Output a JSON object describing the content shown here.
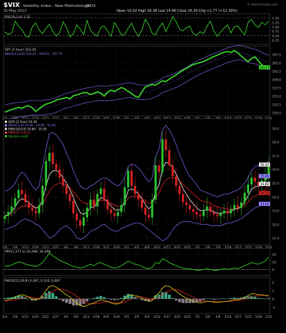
{
  "header": {
    "ticker": "$VIX",
    "name": "Volatility Index - New Methodology",
    "exchange": "INDX",
    "date": "31-May-2013",
    "quote": "Open 16.02  High 16.38  Low 14.96  Close 16.30  Chg +1.77 (+12.18%)",
    "watermark": "© StockCharts.com"
  },
  "colors": {
    "background": "#000000",
    "panel_border": "#3a3a3a",
    "grid": "#2a2a2a",
    "green_line": "#39d52b",
    "up_candle": "#2fbf2f",
    "down_candle": "#d22222",
    "band": "#6a5acd",
    "white_ma": "#e8e8e8",
    "red_ma": "#cc2222",
    "macd": "#d8c31c",
    "signal": "#cc2222",
    "hist_pos": "#3aa98a",
    "hist_neg": "#8a7f88",
    "label": "#bbbbbb"
  },
  "x_axis": {
    "labels": [
      "2/4",
      "2/8",
      "2/13",
      "2/19",
      "2/22",
      "2/27",
      "3/4",
      "3/8",
      "3/13",
      "3/18",
      "3/21",
      "3/26",
      "4/1",
      "4/5",
      "4/9",
      "4/12",
      "4/17",
      "4/22",
      "4/25",
      "5/1",
      "5/6",
      "5/9",
      "5/14",
      "5/17",
      "5/22",
      "5/28",
      "5/31"
    ]
  },
  "chart_data": [
    {
      "panel": "rsi",
      "type": "line",
      "legend": "RSI(20,2.0) 1.32",
      "y_ticks": [
        "1.50",
        "1.25",
        "1.00",
        "0.75",
        "0.50",
        "0.25"
      ],
      "ylim": [
        0.1,
        1.65
      ],
      "values": [
        0.72,
        0.58,
        0.66,
        1.32,
        1.05,
        0.84,
        0.51,
        0.43,
        1.01,
        1.22,
        0.84,
        0.62,
        0.92,
        1.15,
        0.74,
        0.49,
        0.68,
        1.28,
        0.97,
        0.44,
        0.63,
        1.11,
        0.88,
        0.56,
        1.36,
        0.81,
        0.59,
        0.49,
        0.97,
        1.05,
        0.76,
        0.48,
        1.24,
        0.95,
        0.53,
        0.58,
        0.93,
        1.21,
        0.77,
        0.47,
        0.82,
        1.43,
        1.12,
        0.63,
        0.57,
        0.96,
        1.22,
        0.74,
        1.14,
        1.58,
        1.28,
        0.88,
        0.78,
        0.96,
        1.04,
        0.61,
        0.54,
        0.73,
        0.62,
        1.04,
        1.32,
        0.77,
        0.48,
        0.72,
        0.94,
        1.11,
        0.66,
        1.02,
        1.05,
        0.79,
        0.56,
        1.25,
        1.41,
        1.12,
        0.96,
        1.26,
        1.12,
        1.32
      ]
    },
    {
      "panel": "spy",
      "type": "line",
      "legend": "SPY (2 hour) 163.45",
      "legend2": "BB(20,2.0,20) 163.47 - 160.51 - 157.75",
      "y_ticks": [
        "167.5",
        "165.0",
        "162.5",
        "160.0",
        "157.5",
        "155.0",
        "152.5",
        "150.0"
      ],
      "price_box": "163.45",
      "ylim": [
        149.5,
        169.5
      ],
      "values": [
        150.2,
        150.6,
        151.0,
        151.3,
        151.6,
        151.4,
        151.9,
        152.1,
        151.5,
        150.4,
        151.2,
        152.0,
        152.6,
        152.9,
        153.3,
        153.8,
        154.1,
        154.3,
        154.6,
        154.2,
        155.1,
        155.4,
        155.7,
        156.1,
        156.0,
        155.5,
        155.8,
        156.3,
        155.9,
        155.0,
        156.2,
        156.8,
        156.4,
        157.0,
        157.6,
        157.2,
        156.4,
        155.8,
        155.0,
        154.6,
        156.3,
        157.8,
        158.1,
        158.5,
        158.3,
        159.0,
        159.6,
        159.4,
        160.1,
        160.8,
        161.4,
        162.1,
        162.8,
        163.4,
        164.0,
        164.5,
        164.8,
        165.1,
        165.4,
        165.9,
        166.4,
        166.9,
        167.3,
        167.8,
        168.2,
        168.4,
        168.1,
        168.7,
        168.0,
        167.0,
        166.2,
        165.4,
        166.3,
        166.8,
        165.6,
        164.4,
        163.8,
        163.45
      ]
    },
    {
      "panel": "vix",
      "type": "candlestick",
      "legend": [
        {
          "text": "$VIX (2 hour) 16.30",
          "color": "#e8e8e8"
        },
        {
          "text": "BB(20,2.0) 15.46 - 14.80 - 13.44",
          "color": "#8f82ff"
        },
        {
          "text": "EMA(10,0.0) 14.89 - 15.35",
          "color": "#e8e8e8"
        },
        {
          "text": "EMA(10) 14.23",
          "color": "#ff4b4b"
        },
        {
          "text": "Volume undef",
          "color": "#39d52b"
        }
      ],
      "y_ticks": [
        "19.0",
        "18.0",
        "17.0",
        "16.0",
        "15.0",
        "14.0",
        "13.0",
        "12.0",
        "11.0"
      ],
      "price_boxes": [
        "16.30",
        "15.46",
        "14.89",
        "14.23",
        "13.44"
      ],
      "ylim": [
        10.6,
        19.6
      ],
      "values": [
        12.6,
        12.9,
        13.3,
        13.9,
        14.5,
        14.2,
        13.6,
        13.2,
        13.0,
        12.8,
        13.4,
        14.8,
        16.6,
        17.2,
        16.4,
        16.0,
        15.4,
        14.8,
        14.2,
        13.7,
        12.8,
        12.3,
        11.9,
        12.5,
        13.2,
        13.8,
        13.3,
        14.2,
        14.6,
        13.8,
        13.1,
        12.8,
        12.6,
        12.9,
        13.4,
        14.7,
        15.9,
        14.8,
        14.2,
        13.8,
        13.2,
        12.7,
        12.5,
        13.8,
        16.3,
        15.8,
        18.2,
        17.4,
        16.3,
        15.5,
        14.8,
        14.2,
        13.6,
        13.4,
        13.1,
        12.9,
        12.7,
        12.6,
        13.0,
        13.3,
        12.9,
        12.7,
        12.6,
        12.8,
        13.0,
        12.8,
        13.1,
        13.4,
        13.2,
        13.6,
        14.3,
        14.9,
        15.4,
        15.1,
        14.8,
        15.2,
        15.6,
        16.3
      ],
      "upper_band": [
        14.4,
        14.5,
        14.7,
        15.0,
        15.5,
        15.8,
        15.6,
        15.2,
        14.8,
        14.5,
        14.8,
        16.2,
        17.5,
        18.6,
        18.7,
        18.5,
        18.2,
        17.8,
        17.2,
        16.6,
        15.9,
        15.3,
        14.8,
        14.6,
        14.6,
        14.8,
        14.9,
        15.1,
        15.3,
        15.4,
        15.3,
        15.1,
        14.9,
        14.8,
        15.0,
        15.5,
        16.2,
        16.4,
        16.3,
        16.1,
        15.8,
        15.4,
        15.1,
        15.4,
        16.9,
        17.5,
        18.9,
        19.2,
        18.9,
        18.4,
        17.8,
        17.1,
        16.5,
        15.9,
        15.5,
        15.2,
        14.9,
        14.5,
        14.4,
        14.3,
        14.2,
        14.1,
        14.0,
        14.1,
        14.2,
        14.2,
        14.3,
        14.4,
        14.5,
        14.7,
        15.0,
        15.4,
        15.9,
        16.2,
        16.3,
        16.3,
        16.4,
        16.6
      ],
      "lower_band": [
        11.6,
        11.7,
        11.8,
        11.9,
        12.1,
        12.3,
        12.4,
        12.3,
        12.2,
        12.0,
        11.9,
        11.6,
        11.3,
        11.0,
        11.1,
        11.3,
        11.6,
        11.8,
        11.9,
        11.7,
        11.4,
        11.0,
        10.9,
        11.0,
        11.2,
        11.5,
        11.6,
        11.7,
        11.9,
        12.0,
        11.8,
        11.6,
        11.5,
        11.5,
        11.7,
        11.8,
        11.9,
        12.0,
        12.1,
        12.1,
        12.0,
        11.8,
        11.6,
        11.4,
        11.2,
        11.0,
        10.8,
        10.9,
        11.2,
        11.6,
        11.9,
        12.1,
        12.2,
        12.2,
        12.2,
        12.1,
        12.1,
        12.0,
        12.0,
        12.0,
        11.9,
        11.9,
        11.9,
        11.9,
        12.0,
        12.1,
        12.1,
        12.2,
        12.3,
        12.4,
        12.6,
        12.8,
        13.0,
        13.2,
        13.3,
        13.4,
        13.4,
        13.44
      ]
    },
    {
      "panel": "ppo",
      "type": "line",
      "legend": "PPO(1,377,1) 16.298, 16.298",
      "y_ticks": [
        "20",
        "10",
        "0"
      ],
      "ylim": [
        -6,
        26
      ],
      "values": [
        5,
        4,
        6,
        8,
        10,
        9,
        7,
        6,
        5,
        4,
        6,
        9,
        15,
        22,
        18,
        15,
        12,
        10,
        8,
        6,
        4,
        3,
        2,
        3,
        5,
        7,
        5,
        8,
        9,
        7,
        5,
        3,
        2,
        3,
        5,
        8,
        11,
        9,
        7,
        6,
        4,
        2,
        1,
        3,
        9,
        8,
        14,
        12,
        9,
        7,
        5,
        3,
        2,
        1,
        1,
        0,
        -1,
        -1,
        0,
        1,
        0,
        -1,
        -1,
        0,
        1,
        0,
        1,
        2,
        1,
        3,
        5,
        7,
        9,
        8,
        7,
        9,
        11,
        16.3
      ]
    },
    {
      "panel": "macd",
      "type": "line",
      "legend": "MACD(12,26,9) 0.397, 0.310, 0.087",
      "y_ticks": [
        "2",
        "1",
        "0",
        "-1"
      ],
      "ylim": [
        -1.6,
        2.4
      ],
      "macd": [
        -0.2,
        -0.1,
        0.0,
        0.2,
        0.4,
        0.5,
        0.4,
        0.2,
        0.0,
        -0.1,
        0.0,
        0.4,
        1.0,
        1.5,
        1.6,
        1.4,
        1.1,
        0.8,
        0.5,
        0.2,
        -0.2,
        -0.5,
        -0.8,
        -0.9,
        -0.8,
        -0.6,
        -0.5,
        -0.3,
        -0.1,
        -0.2,
        -0.3,
        -0.5,
        -0.6,
        -0.6,
        -0.4,
        0.0,
        0.4,
        0.5,
        0.4,
        0.3,
        0.1,
        -0.1,
        -0.3,
        -0.2,
        0.4,
        0.7,
        1.3,
        1.6,
        1.5,
        1.2,
        0.9,
        0.6,
        0.3,
        0.1,
        -0.1,
        -0.3,
        -0.4,
        -0.5,
        -0.4,
        -0.3,
        -0.3,
        -0.4,
        -0.4,
        -0.4,
        -0.3,
        -0.3,
        -0.2,
        -0.1,
        -0.1,
        0.0,
        0.2,
        0.4,
        0.6,
        0.6,
        0.5,
        0.5,
        0.4,
        0.397
      ],
      "signal": [
        -0.3,
        -0.25,
        -0.2,
        -0.1,
        0.0,
        0.15,
        0.25,
        0.25,
        0.2,
        0.1,
        0.05,
        0.1,
        0.3,
        0.6,
        0.9,
        1.1,
        1.2,
        1.1,
        1.0,
        0.8,
        0.6,
        0.3,
        0.0,
        -0.3,
        -0.5,
        -0.6,
        -0.6,
        -0.55,
        -0.45,
        -0.4,
        -0.35,
        -0.4,
        -0.45,
        -0.5,
        -0.5,
        -0.4,
        -0.2,
        0.0,
        0.15,
        0.25,
        0.25,
        0.15,
        0.0,
        -0.1,
        0.0,
        0.2,
        0.5,
        0.8,
        1.0,
        1.1,
        1.1,
        1.0,
        0.8,
        0.6,
        0.4,
        0.2,
        0.0,
        -0.15,
        -0.25,
        -0.3,
        -0.3,
        -0.3,
        -0.35,
        -0.35,
        -0.35,
        -0.3,
        -0.3,
        -0.25,
        -0.2,
        -0.15,
        -0.05,
        0.1,
        0.25,
        0.35,
        0.4,
        0.42,
        0.4,
        0.31
      ]
    }
  ]
}
